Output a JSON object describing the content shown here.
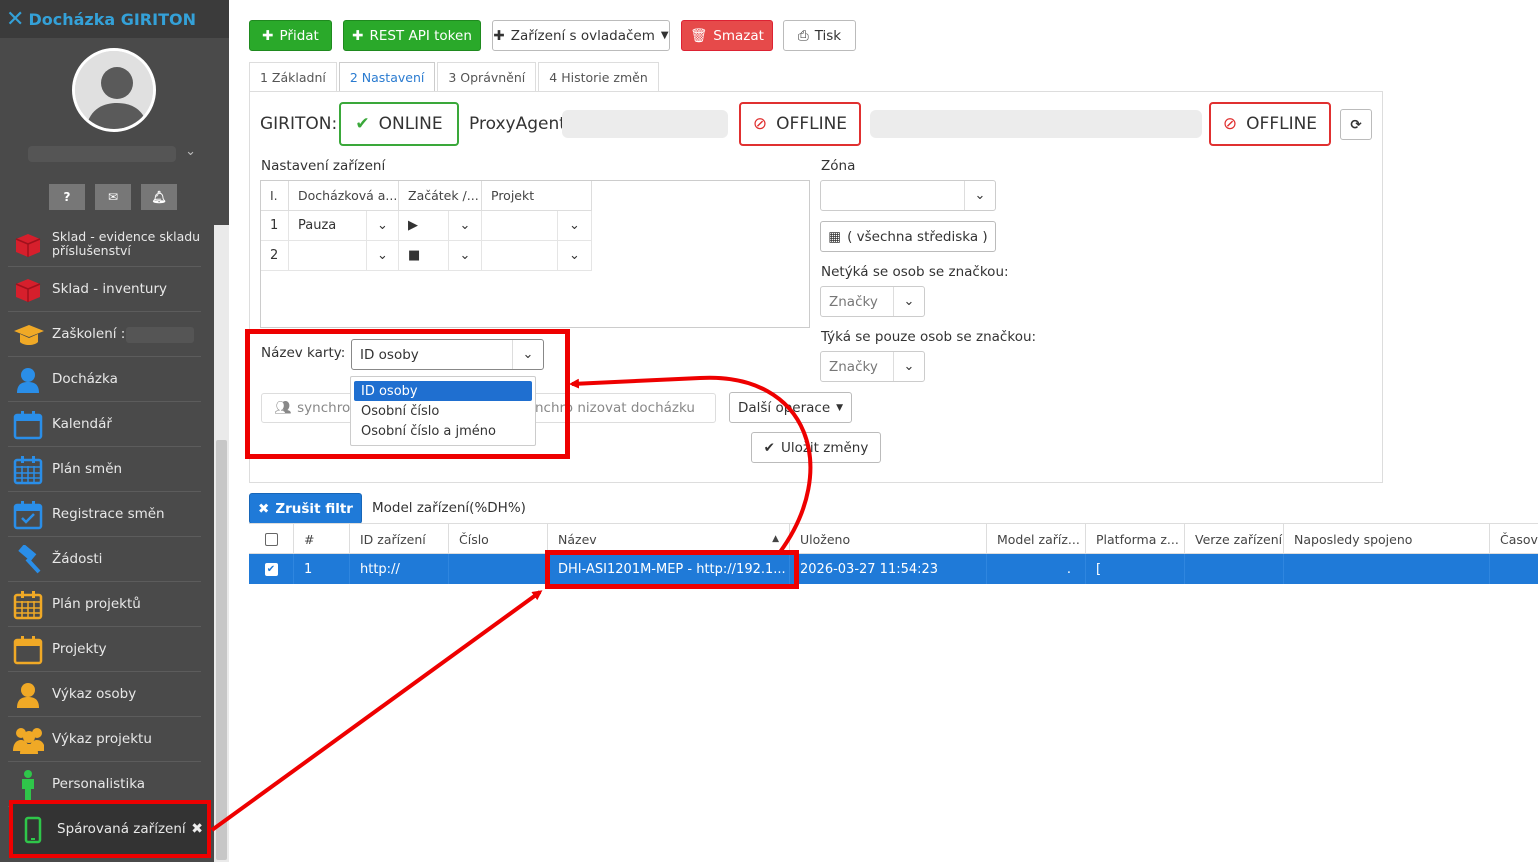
{
  "brand": {
    "title": "Docházka GIRITON",
    "logo_icon": "x-logo-icon",
    "color": "#34a1d8"
  },
  "sidebar": {
    "top_icons": [
      {
        "icon": "question-icon",
        "glyph": "?"
      },
      {
        "icon": "mail-icon",
        "glyph": "✉"
      },
      {
        "icon": "bell-icon",
        "glyph": "▲"
      }
    ],
    "items": [
      {
        "label": "Sklad - evidence skladu příslušenství",
        "icon": "box-icon"
      },
      {
        "label": "Sklad - inventury",
        "icon": "box-icon"
      },
      {
        "label": "Zaškolení :",
        "icon": "graduation-cap-icon"
      },
      {
        "label": "Docházka",
        "icon": "person-icon"
      },
      {
        "label": "Kalendář",
        "icon": "calendar-icon"
      },
      {
        "label": "Plán směn",
        "icon": "calendar-grid-icon"
      },
      {
        "label": "Registrace směn",
        "icon": "calendar-check-icon"
      },
      {
        "label": "Žádosti",
        "icon": "gavel-icon"
      },
      {
        "label": "Plán projektů",
        "icon": "calendar-grid-icon"
      },
      {
        "label": "Projekty",
        "icon": "calendar-icon"
      },
      {
        "label": "Výkaz osoby",
        "icon": "person-icon"
      },
      {
        "label": "Výkaz projektu",
        "icon": "group-icon"
      },
      {
        "label": "Personalistika",
        "icon": "figure-icon"
      },
      {
        "label": "Spárovaná zařízení",
        "icon": "phone-icon",
        "close": "✖"
      }
    ]
  },
  "toolbar": {
    "add": "Přidat",
    "rest": "REST API token",
    "devices": "Zařízení s ovladačem",
    "delete": "Smazat",
    "print": "Tisk"
  },
  "tabs": [
    "1 Základní",
    "2 Nastavení",
    "3 Oprávnění",
    "4 Historie změn"
  ],
  "status": {
    "giriton_label": "GIRITON:",
    "online": "ONLINE",
    "proxy_label": "ProxyAgent",
    "offline1": "OFFLINE",
    "offline2": "OFFLINE",
    "colors": {
      "online": "#3aa83a",
      "offline": "#e03030"
    }
  },
  "settings": {
    "title": "Nastavení zařízení",
    "columns": [
      "I.",
      "Docházková a...",
      "Začátek /...",
      "Projekt"
    ],
    "rows": [
      {
        "n": "1",
        "type": "Pauza",
        "start": "▶"
      },
      {
        "n": "2",
        "type": "",
        "start": "■"
      }
    ],
    "card_label": "Název karty:",
    "card_value": "ID osoby",
    "card_options": [
      "ID osoby",
      "Osobní číslo",
      "Osobní číslo a jméno"
    ],
    "sync1": "synchroniz",
    "sync2": "nchro nizovat docházku",
    "more_ops": "Další operace",
    "save": "Uložit změny"
  },
  "zone": {
    "label": "Zóna",
    "all_centers": "( všechna střediska )",
    "not_label": "Netýká se osob se značkou:",
    "only_label": "Týká se pouze osob se značkou:",
    "tags_ph": "Značky"
  },
  "filter": {
    "cancel": "Zrušit filtr",
    "text": "Model zařízení(%DH%)"
  },
  "table": {
    "columns": [
      "#",
      "ID zařízení",
      "Číslo",
      "Název",
      "Uloženo",
      "Model zaříz...",
      "Platforma z...",
      "Verze zařízení",
      "Naposledy spojeno",
      "Časová"
    ],
    "row": {
      "n": "1",
      "id": "http://",
      "number": "",
      "name": "DHI-ASI1201M-MEP - http://192.1...",
      "saved": "2026-03-27 11:54:23",
      "model": ".",
      "platform": "["
    }
  }
}
